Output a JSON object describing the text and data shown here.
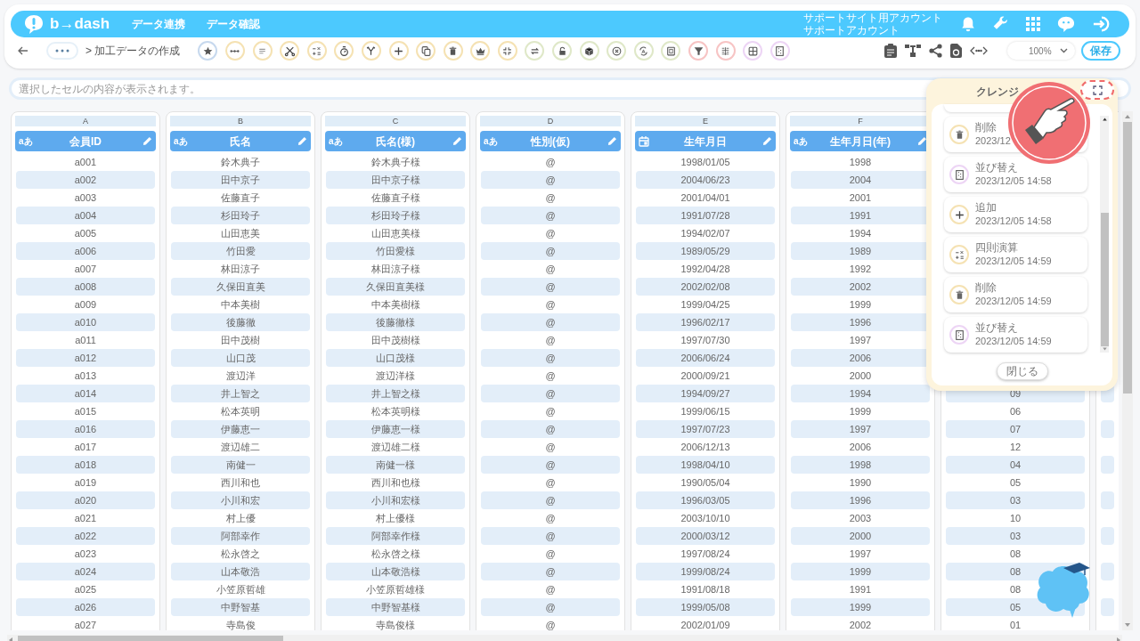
{
  "header": {
    "logo": "b→dash",
    "nav": [
      {
        "label": "データ連携"
      },
      {
        "label": "データ確認"
      }
    ],
    "account": {
      "site": "サポートサイト用アカウント",
      "name": "サポートアカウント"
    }
  },
  "toolbar": {
    "breadcrumb": "> 加工データの作成",
    "zoom": "100%",
    "save": "保存"
  },
  "cell_bar": {
    "placeholder": "選択したセルの内容が表示されます。"
  },
  "table": {
    "columns": [
      {
        "letter": "A",
        "kind": "text",
        "type_label": "aあ",
        "name": "会員ID"
      },
      {
        "letter": "B",
        "kind": "text",
        "type_label": "aあ",
        "name": "氏名"
      },
      {
        "letter": "C",
        "kind": "text",
        "type_label": "aあ",
        "name": "氏名(様)"
      },
      {
        "letter": "D",
        "kind": "text",
        "type_label": "aあ",
        "name": "性別(仮)"
      },
      {
        "letter": "E",
        "kind": "date",
        "name": "生年月日"
      },
      {
        "letter": "F",
        "kind": "text",
        "type_label": "aあ",
        "name": "生年月日(年)"
      }
    ],
    "rows": [
      {
        "cells": [
          "a001",
          "鈴木典子",
          "鈴木典子様",
          "@",
          "1998/01/05",
          "1998"
        ]
      },
      {
        "cells": [
          "a002",
          "田中京子",
          "田中京子様",
          "@",
          "2004/06/23",
          "2004"
        ]
      },
      {
        "cells": [
          "a003",
          "佐藤直子",
          "佐藤直子様",
          "@",
          "2001/04/01",
          "2001"
        ]
      },
      {
        "cells": [
          "a004",
          "杉田玲子",
          "杉田玲子様",
          "@",
          "1991/07/28",
          "1991"
        ]
      },
      {
        "cells": [
          "a005",
          "山田恵美",
          "山田恵美様",
          "@",
          "1994/02/07",
          "1994"
        ]
      },
      {
        "cells": [
          "a006",
          "竹田愛",
          "竹田愛様",
          "@",
          "1989/05/29",
          "1989"
        ]
      },
      {
        "cells": [
          "a007",
          "林田涼子",
          "林田涼子様",
          "@",
          "1992/04/28",
          "1992"
        ]
      },
      {
        "cells": [
          "a008",
          "久保田直美",
          "久保田直美様",
          "@",
          "2002/02/08",
          "2002"
        ]
      },
      {
        "cells": [
          "a009",
          "中本美樹",
          "中本美樹様",
          "@",
          "1999/04/25",
          "1999"
        ]
      },
      {
        "cells": [
          "a010",
          "後藤徹",
          "後藤徹様",
          "@",
          "1996/02/17",
          "1996"
        ]
      },
      {
        "cells": [
          "a011",
          "田中茂樹",
          "田中茂樹様",
          "@",
          "1997/07/30",
          "1997"
        ]
      },
      {
        "cells": [
          "a012",
          "山口茂",
          "山口茂様",
          "@",
          "2006/06/24",
          "2006"
        ]
      },
      {
        "cells": [
          "a013",
          "渡辺洋",
          "渡辺洋様",
          "@",
          "2000/09/21",
          "2000"
        ]
      },
      {
        "cells": [
          "a014",
          "井上智之",
          "井上智之様",
          "@",
          "1994/09/27",
          "1994"
        ],
        "column_7": "09"
      },
      {
        "cells": [
          "a015",
          "松本英明",
          "松本英明様",
          "@",
          "1999/06/15",
          "1999"
        ],
        "column_7": "06"
      },
      {
        "cells": [
          "a016",
          "伊藤恵一",
          "伊藤恵一様",
          "@",
          "1997/07/23",
          "1997"
        ],
        "column_7": "07"
      },
      {
        "cells": [
          "a017",
          "渡辺雄二",
          "渡辺雄二様",
          "@",
          "2006/12/13",
          "2006"
        ],
        "column_7": "12"
      },
      {
        "cells": [
          "a018",
          "南健一",
          "南健一様",
          "@",
          "1998/04/10",
          "1998"
        ],
        "column_7": "04"
      },
      {
        "cells": [
          "a019",
          "西川和也",
          "西川和也様",
          "@",
          "1990/05/04",
          "1990"
        ],
        "column_7": "05"
      },
      {
        "cells": [
          "a020",
          "小川和宏",
          "小川和宏様",
          "@",
          "1996/03/05",
          "1996"
        ],
        "column_7": "03"
      },
      {
        "cells": [
          "a021",
          "村上優",
          "村上優様",
          "@",
          "2003/10/10",
          "2003"
        ],
        "column_7": "10"
      },
      {
        "cells": [
          "a022",
          "阿部幸作",
          "阿部幸作様",
          "@",
          "2000/03/12",
          "2000"
        ],
        "column_7": "03"
      },
      {
        "cells": [
          "a023",
          "松永啓之",
          "松永啓之様",
          "@",
          "1997/08/24",
          "1997"
        ],
        "column_7": "08"
      },
      {
        "cells": [
          "a024",
          "山本敬浩",
          "山本敬浩様",
          "@",
          "1999/08/24",
          "1999"
        ],
        "column_7": "08"
      },
      {
        "cells": [
          "a025",
          "小笠原哲雄",
          "小笠原哲雄様",
          "@",
          "1991/08/18",
          "1991"
        ],
        "column_7": "08"
      },
      {
        "cells": [
          "a026",
          "中野智基",
          "中野智基様",
          "@",
          "1999/05/08",
          "1999"
        ],
        "column_7": "05"
      },
      {
        "cells": [
          "a027",
          "寺島俊",
          "寺島俊様",
          "@",
          "2002/01/09",
          "2002"
        ],
        "column_7": "01"
      }
    ]
  },
  "history_panel": {
    "title": "クレンジ",
    "items": [
      {
        "kind": "delete",
        "label": "削除",
        "time": "2023/12"
      },
      {
        "kind": "sort",
        "label": "並び替え",
        "time": "2023/12/05 14:58"
      },
      {
        "kind": "add",
        "label": "追加",
        "time": "2023/12/05 14:58"
      },
      {
        "kind": "arithmetic",
        "label": "四則演算",
        "time": "2023/12/05 14:59"
      },
      {
        "kind": "delete",
        "label": "削除",
        "time": "2023/12/05 14:59"
      },
      {
        "kind": "sort",
        "label": "並び替え",
        "time": "2023/12/05 14:59"
      }
    ],
    "close": "閉じる"
  }
}
